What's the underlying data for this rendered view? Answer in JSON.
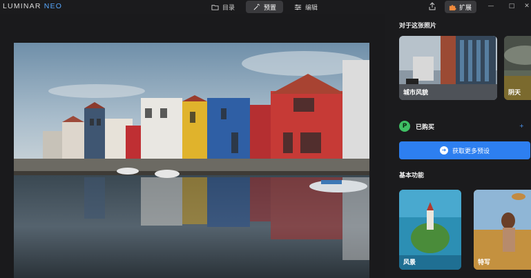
{
  "app": {
    "logo_main": "LUMINAR ",
    "logo_accent": "NEO"
  },
  "tabs": [
    {
      "label": "目录",
      "icon": "folder-icon"
    },
    {
      "label": "预置",
      "icon": "magic-wand-icon",
      "active": true
    },
    {
      "label": "编辑",
      "icon": "sliders-icon"
    }
  ],
  "header": {
    "extensions_label": "扩展",
    "share_icon": "share-icon"
  },
  "panel": {
    "about_title": "对于这张照片",
    "suggestions": [
      {
        "label": "城市风貌"
      },
      {
        "label": "阴天"
      }
    ],
    "purchased_label": "已购买",
    "purchased_icon_glyph": "P",
    "more_link": "+",
    "get_more_label": "获取更多预设",
    "basic_title": "基本功能",
    "basics": [
      {
        "label": "风景"
      },
      {
        "label": "特写"
      }
    ]
  },
  "colors": {
    "accent": "#2d7ff0",
    "link": "#4d9dff",
    "purchased": "#3fbf64"
  }
}
